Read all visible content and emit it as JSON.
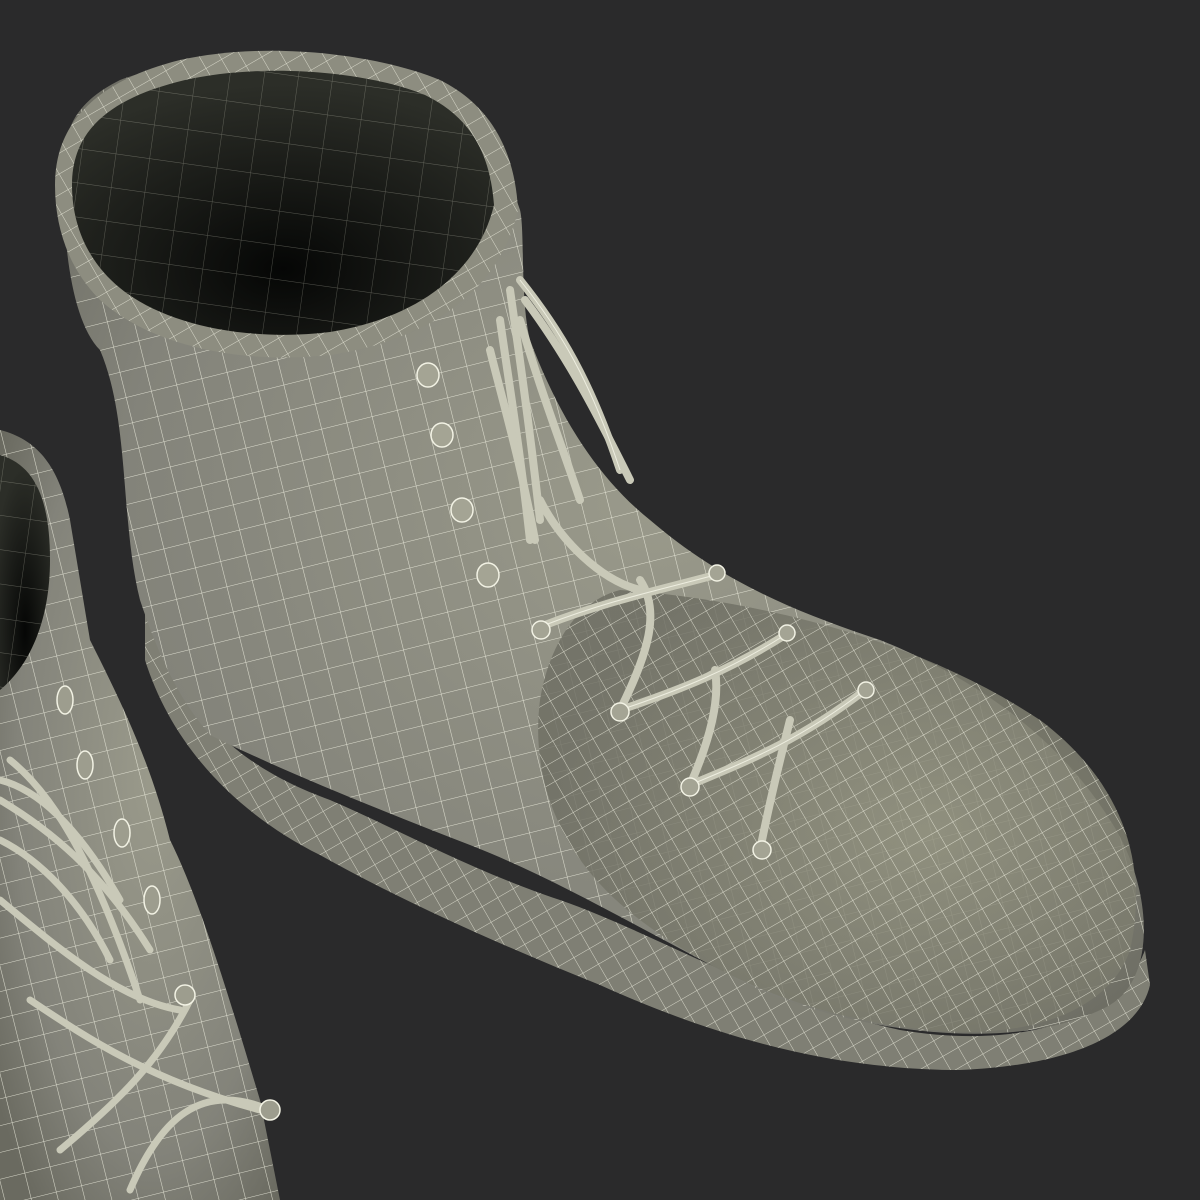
{
  "scene": {
    "subject": "wireframe-render-of-lace-up-boots",
    "colors": {
      "background": "#2a2a2b",
      "boot_surface": "#8e8e80",
      "boot_highlight": "#a8a898",
      "boot_shadow": "#5e5e54",
      "boot_interior": "#1c1d1a",
      "wire": "#f2f2e4"
    }
  }
}
